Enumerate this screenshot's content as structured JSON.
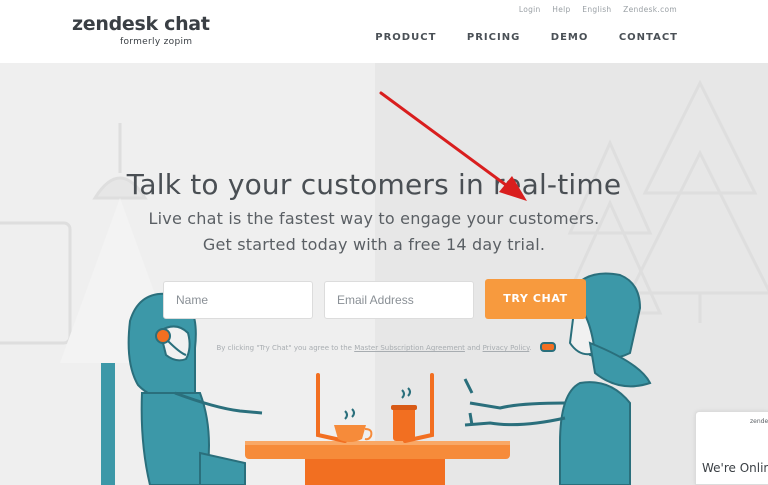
{
  "header": {
    "logo": "zendesk chat",
    "logo_sub": "formerly zopim",
    "utility": [
      "Login",
      "Help",
      "English",
      "Zendesk.com"
    ],
    "nav": [
      "PRODUCT",
      "PRICING",
      "DEMO",
      "CONTACT"
    ]
  },
  "hero": {
    "headline": "Talk to your customers in real-time",
    "sub1": "Live chat is the fastest way to engage your customers.",
    "sub2": "Get started today with a free 14 day trial.",
    "name_placeholder": "Name",
    "email_placeholder": "Email Address",
    "cta": "TRY CHAT",
    "terms_pre": "By clicking \"Try Chat\" you agree to the",
    "terms_link1": "Master Subscription Agreement",
    "terms_and": "and",
    "terms_link2": "Privacy Policy",
    "terms_end": "."
  },
  "widget": {
    "brand": "zendesk",
    "status": "We're Online"
  },
  "colors": {
    "accent": "#f79a3e",
    "teal": "#3c98a8",
    "dark_teal": "#2a6f7c",
    "orange": "#f26f21",
    "arrow": "#d91e1e"
  }
}
